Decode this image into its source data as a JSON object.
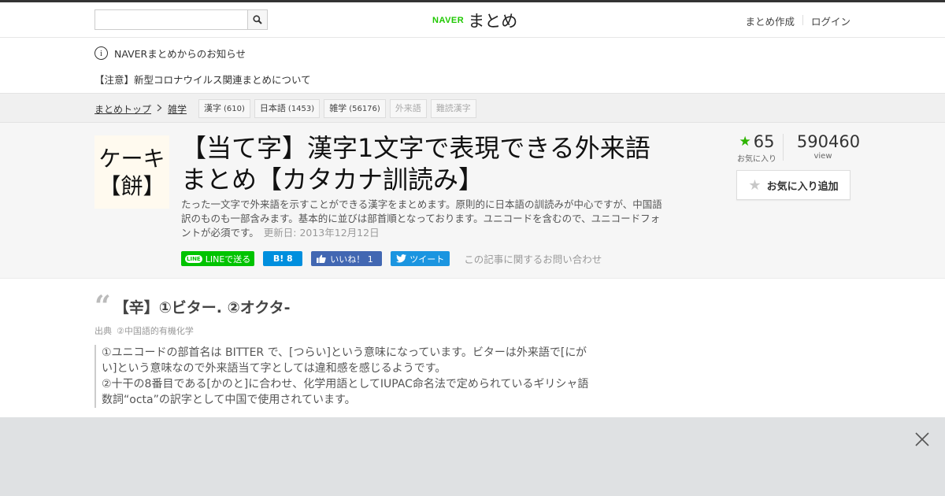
{
  "header": {
    "search": {
      "placeholder": "",
      "value": ""
    },
    "logo_brand": "NAVER",
    "logo_text": "まとめ",
    "links": [
      "まとめ作成",
      "ログイン"
    ]
  },
  "notice": {
    "title": "NAVERまとめからのお知らせ",
    "item": "【注意】新型コロナウイルス関連まとめについて"
  },
  "breadcrumb": {
    "items": [
      "まとめトップ",
      "雑学"
    ],
    "tags": [
      {
        "label": "漢字",
        "count": "(610)"
      },
      {
        "label": "日本語",
        "count": "(1453)"
      },
      {
        "label": "雑学",
        "count": "(56176)"
      },
      {
        "label": "外来語",
        "count": ""
      },
      {
        "label": "難読漢字",
        "count": ""
      }
    ]
  },
  "article": {
    "thumbnail_line1": "ケーキ",
    "thumbnail_line2": "【餅】",
    "title": "【当て字】漢字1文字で表現できる外来語まとめ【カタカナ訓読み】",
    "description": "たった一文字で外来語を示すことができる漢字をまとめます。原則的に日本語の訓読みが中心ですが、中国語訳のものも一部含みます。基本的に並びは部首順となっております。ユニコードを含むので、ユニコードフォントが必須です。",
    "updated": "更新日: 2013年12月12日",
    "favorites_count": "65",
    "favorites_label": "お気に入り",
    "views_count": "590460",
    "views_label": "view",
    "fav_button": "お気に入り追加",
    "share": {
      "line": "LINEで送る",
      "line_badge": "LINE",
      "hatena": "B! 8",
      "facebook": "いいね！ 1",
      "twitter": "ツイート",
      "inquiry": "この記事に関するお問い合わせ"
    }
  },
  "quote": {
    "heading": "【辛】①ビター. ②オクタ-",
    "source_label": "出典",
    "source_name": "②中国語的有機化学",
    "body": "①ユニコードの部首名は BITTER で、[つらい]という意味になっています。ビターは外来語で[にがい]という意味なので外来語当て字としては違和感を感じるようです。\n②十干の8番目である[かのと]に合わせ、化学用語としてIUPAC命名法で定められているギリシャ語数詞“octa”の訳字として中国で使用されています。"
  },
  "colors": {
    "brand_green": "#1ec800",
    "star_green": "#2db400",
    "line_green": "#00c300",
    "hatena_blue": "#008fde",
    "facebook_blue": "#4267b2",
    "twitter_blue": "#1b95e0"
  },
  "icons": [
    "search-icon",
    "info-icon",
    "chevron-right-icon",
    "star-icon",
    "star-outline-icon",
    "quote-icon",
    "close-icon",
    "facebook-like-icon",
    "twitter-bird-icon"
  ]
}
